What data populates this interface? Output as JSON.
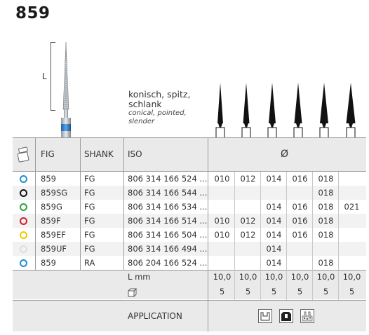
{
  "title": "859",
  "shape_label": "L",
  "description": {
    "de_line1": "konisch, spitz,",
    "de_line2": "schlank",
    "en_line1": "conical, pointed,",
    "en_line2": "slender"
  },
  "table": {
    "headers": {
      "fig": "FIG",
      "shank": "SHANK",
      "iso": "ISO",
      "diameter": "Ø"
    },
    "rows": [
      {
        "ring_color": "#1a8fd6",
        "fig": "859",
        "shank": "FG",
        "iso": "806 314 166 524 ...",
        "sizes": [
          "010",
          "012",
          "014",
          "016",
          "018",
          ""
        ]
      },
      {
        "ring_color": "#111111",
        "fig": "859SG",
        "shank": "FG",
        "iso": "806 314 166 544 ...",
        "sizes": [
          "",
          "",
          "",
          "",
          "018",
          ""
        ]
      },
      {
        "ring_color": "#2fa33a",
        "fig": "859G",
        "shank": "FG",
        "iso": "806 314 166 534 ...",
        "sizes": [
          "",
          "",
          "014",
          "016",
          "018",
          "021"
        ]
      },
      {
        "ring_color": "#d4202a",
        "fig": "859F",
        "shank": "FG",
        "iso": "806 314 166 514 ...",
        "sizes": [
          "010",
          "012",
          "014",
          "016",
          "018",
          ""
        ]
      },
      {
        "ring_color": "#f0c800",
        "fig": "859EF",
        "shank": "FG",
        "iso": "806 314 166 504 ...",
        "sizes": [
          "010",
          "012",
          "014",
          "016",
          "018",
          ""
        ]
      },
      {
        "ring_color": "#dddddd",
        "fig": "859UF",
        "shank": "FG",
        "iso": "806 314 166 494 ...",
        "sizes": [
          "",
          "",
          "014",
          "",
          "",
          ""
        ]
      },
      {
        "ring_color": "#1a8fd6",
        "fig": "859",
        "shank": "RA",
        "iso": "806 204 166 524 ...",
        "sizes": [
          "",
          "",
          "014",
          "",
          "018",
          ""
        ]
      }
    ],
    "length_label": "L mm",
    "lengths": [
      "10,0",
      "10,0",
      "10,0",
      "10,0",
      "10,0",
      "10,0"
    ],
    "pack_icon": "box-icon",
    "packs": [
      "5",
      "5",
      "5",
      "5",
      "5",
      "5"
    ],
    "application_label": "APPLICATION",
    "application_icons": [
      "cavity-icon",
      "crown-prep-icon",
      "bone-icon"
    ]
  }
}
